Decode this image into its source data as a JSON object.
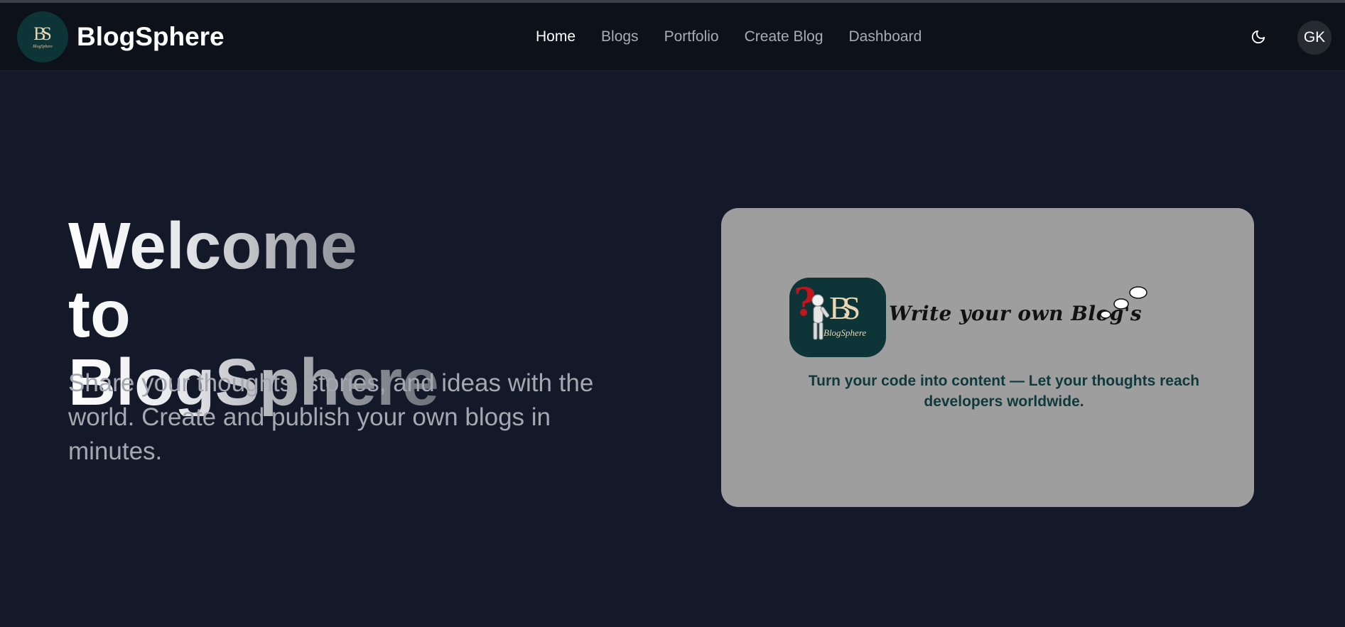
{
  "navbar": {
    "brand_name": "BlogSphere",
    "logo_monogram": "BS",
    "logo_wordmark": "BlogSphere",
    "links": [
      {
        "label": "Home",
        "active": true
      },
      {
        "label": "Blogs",
        "active": false
      },
      {
        "label": "Portfolio",
        "active": false
      },
      {
        "label": "Create Blog",
        "active": false
      },
      {
        "label": "Dashboard",
        "active": false
      }
    ],
    "theme_icon": "moon-icon",
    "avatar_initials": "GK"
  },
  "hero": {
    "title_line1": "Welcome to",
    "title_line2": "BlogSphere",
    "subtitle": "Share your thoughts, stories, and ideas with the world. Create and publish your own blogs in minutes."
  },
  "card": {
    "logo_monogram": "BS",
    "logo_wordmark": "BlogSphere",
    "tagline": "Write your own Blog's",
    "caption": "Turn your code into content — Let your thoughts reach developers worldwide."
  },
  "colors": {
    "page_background": "#131928",
    "navbar_background": "#0d1119",
    "card_background": "#9e9e9e",
    "logo_background": "#0d3436",
    "caption_color": "#0f3a3b"
  }
}
